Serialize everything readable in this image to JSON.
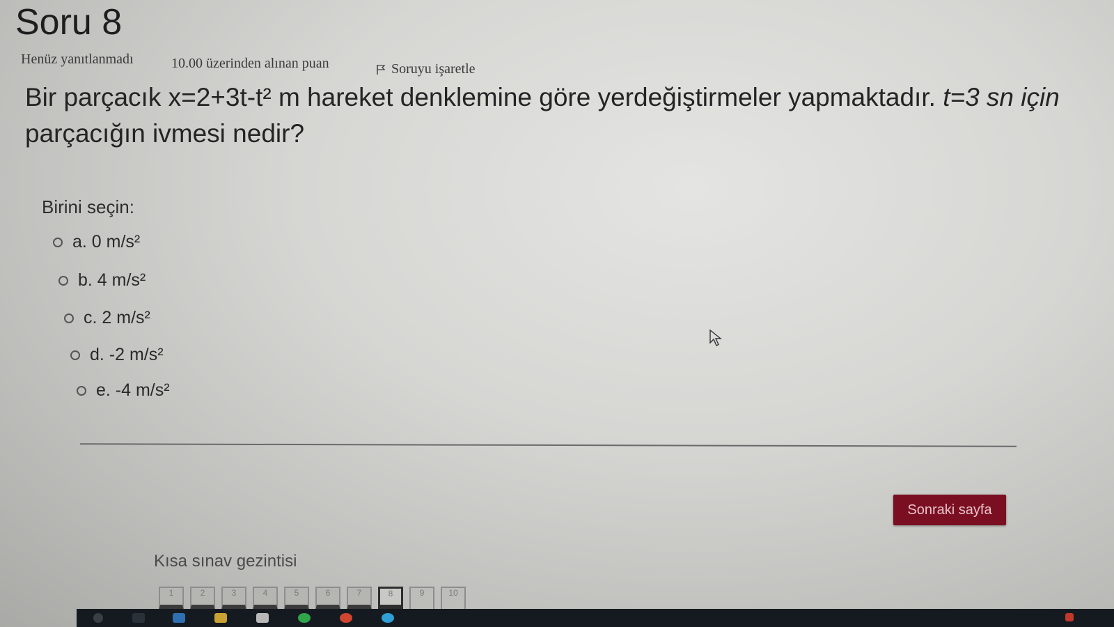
{
  "page": {
    "title": "Soru 8",
    "status": "Henüz yanıtlanmadı",
    "score": "10.00 üzerinden alınan puan",
    "flag_label": "Soruyu işaretle"
  },
  "question": {
    "part1": "Bir parçacık x=2+3t-t² m hareket denklemine göre yerdeğiştirmeler yapmaktadır.",
    "part2": "t=3 sn için",
    "part3": "parçacığın ivmesi nedir?"
  },
  "answers": {
    "prompt": "Birini seçin:",
    "options": [
      {
        "label": "a. 0 m/s²"
      },
      {
        "label": "b. 4 m/s²"
      },
      {
        "label": "c. 2 m/s²"
      },
      {
        "label": "d. -2 m/s²"
      },
      {
        "label": "e. -4 m/s²"
      }
    ]
  },
  "actions": {
    "next_label": "Sonraki sayfa"
  },
  "navigation": {
    "title": "Kısa sınav gezintisi",
    "pages": [
      "1",
      "2",
      "3",
      "4",
      "5",
      "6",
      "7",
      "8",
      "9",
      "10"
    ],
    "current": "8"
  },
  "colors": {
    "accent": "#7b0f22"
  }
}
